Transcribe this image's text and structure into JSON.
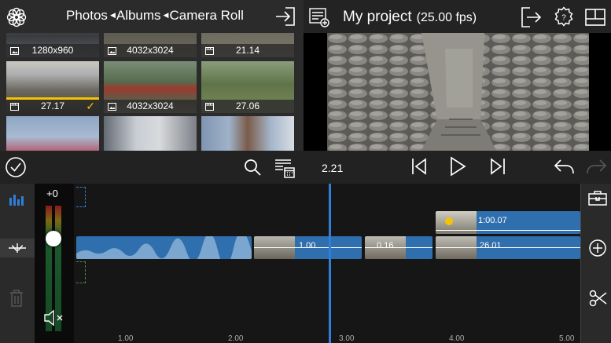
{
  "browser": {
    "breadcrumb": [
      "Photos",
      "Albums",
      "Camera Roll"
    ],
    "thumbnails": [
      {
        "caption": "1280x960",
        "kind": "photo"
      },
      {
        "caption": "4032x3024",
        "kind": "photo"
      },
      {
        "caption": "21.14",
        "kind": "video"
      },
      {
        "caption": "27.17",
        "kind": "video",
        "selected": true
      },
      {
        "caption": "4032x3024",
        "kind": "photo"
      },
      {
        "caption": "27.06",
        "kind": "video"
      }
    ]
  },
  "project": {
    "title": "My project",
    "fps": "(25.00 fps)"
  },
  "playback": {
    "current_time": "2.21"
  },
  "mixer": {
    "gain_label": "+0"
  },
  "timeline": {
    "ruler": [
      "1.00",
      "2.00",
      "3.00",
      "4.00",
      "5.00"
    ],
    "clips": [
      {
        "label": "1.00"
      },
      {
        "label": "0.16"
      },
      {
        "label": "26.01"
      },
      {
        "label": "1:00.07"
      }
    ]
  },
  "colors": {
    "accent": "#2e7fd9",
    "selection": "#f4c400",
    "clip": "#2f6fae"
  }
}
